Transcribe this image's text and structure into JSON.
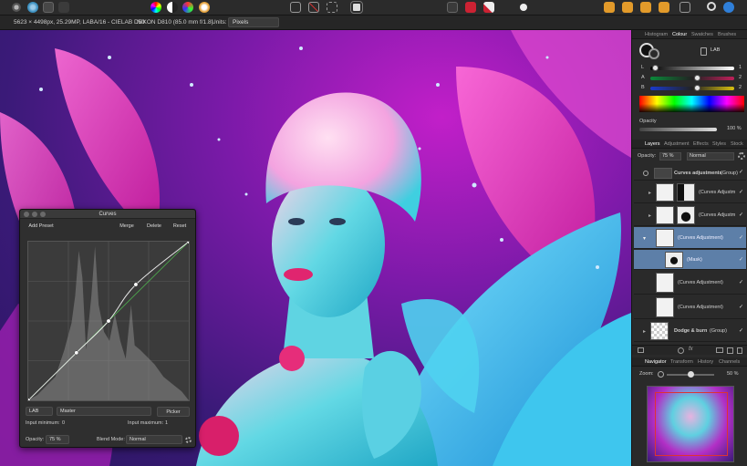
{
  "context_bar": {
    "doc_info": "5623 × 4498px, 25.29MP, LABA/16 - CIELAB D50",
    "camera": "NIKON D810 (85.0 mm f/1.8)",
    "units_label": "Units:",
    "units_value": "Pixels"
  },
  "panel": {
    "top_tabs": [
      "Histogram",
      "Colour",
      "Swatches",
      "Brushes"
    ],
    "active_top_tab": "Colour",
    "colour_mode": "LAB",
    "sliders": [
      {
        "label": "L",
        "value": "1",
        "level": 0.05
      },
      {
        "label": "A",
        "value": "2",
        "level": 0.55
      },
      {
        "label": "B",
        "value": "2",
        "level": 0.55
      }
    ],
    "opacity_label": "Opacity",
    "opacity_value": "100 %",
    "layer_tabs": [
      "Layers",
      "Adjustment",
      "Effects",
      "Styles",
      "Stock"
    ],
    "active_layer_tab": "Layers",
    "layers_opacity_label": "Opacity:",
    "layers_opacity_value": "75 %",
    "blend_value": "Normal",
    "layers": [
      {
        "name": "Curves adjustments",
        "suffix": "(Group)",
        "bold": true
      },
      {
        "name": "(Curves Adjustm",
        "suffix": "",
        "bold": false
      },
      {
        "name": "(Curves Adjustm",
        "suffix": "",
        "bold": false
      },
      {
        "name": "(Curves Adjustment)",
        "suffix": "",
        "bold": false
      },
      {
        "name": "(Mask)",
        "suffix": "",
        "bold": false
      },
      {
        "name": "(Curves Adjustment)",
        "suffix": "",
        "bold": false
      },
      {
        "name": "(Curves Adjustment)",
        "suffix": "",
        "bold": false
      },
      {
        "name": "Dodge & burn",
        "suffix": "(Group)",
        "bold": true
      }
    ],
    "nav_tabs": [
      "Navigator",
      "Transform",
      "History",
      "Channels"
    ],
    "active_nav_tab": "Navigator",
    "zoom_label": "Zoom:",
    "zoom_value": "50 %",
    "zoom_level": 0.5
  },
  "curves": {
    "title": "Curves",
    "add_preset": "Add Preset",
    "merge": "Merge",
    "delete": "Delete",
    "reset": "Reset",
    "colour_space": "LAB",
    "channel": "Master",
    "picker": "Picker",
    "input_min_label": "Input minimum:",
    "input_min_value": "0",
    "input_max_label": "Input maximum:",
    "input_max_value": "1",
    "opacity_label": "Opacity:",
    "opacity_value": "75 %",
    "blend_label": "Blend Mode:",
    "blend_value": "Normal",
    "curve_points": [
      [
        0,
        0
      ],
      [
        0.3,
        0.3
      ],
      [
        0.5,
        0.5
      ],
      [
        0.67,
        0.73
      ],
      [
        1,
        1
      ]
    ]
  }
}
